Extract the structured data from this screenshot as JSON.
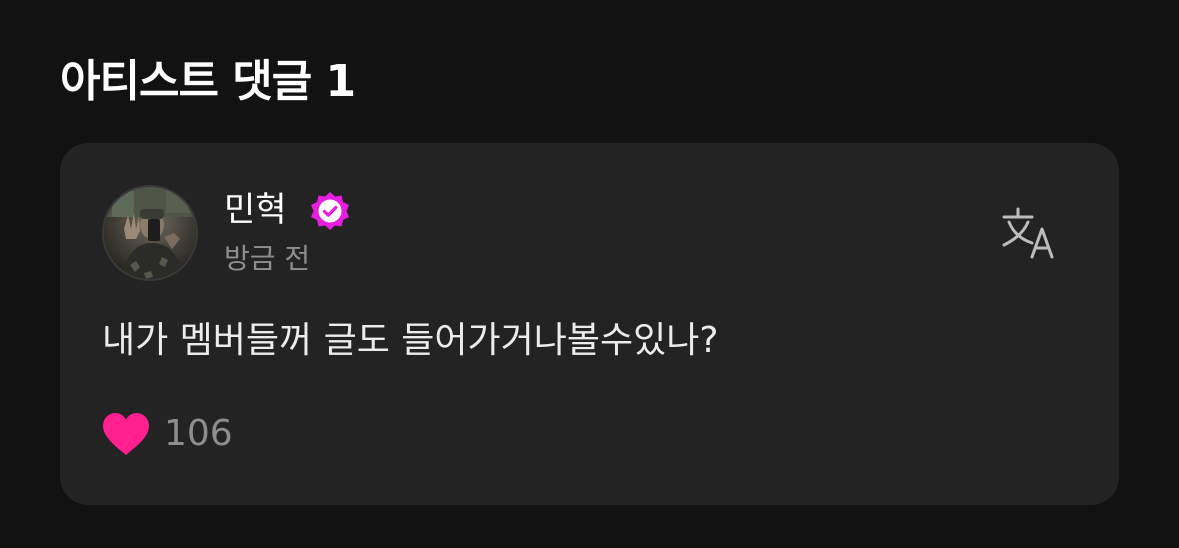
{
  "section": {
    "title": "아티스트 댓글 1"
  },
  "comment": {
    "author": "민혁",
    "timestamp": "방금 전",
    "text": "내가 멤버들꺼 글도 들어가거나볼수있나?",
    "likes": "106"
  },
  "colors": {
    "background": "#121212",
    "card": "#232323",
    "verified_badge": "#e51ee0",
    "heart": "#ff1f8f",
    "muted_text": "#8e8e8e"
  },
  "icons": {
    "verified": "verified-badge-icon",
    "translate": "translate-icon",
    "like": "heart-icon"
  }
}
